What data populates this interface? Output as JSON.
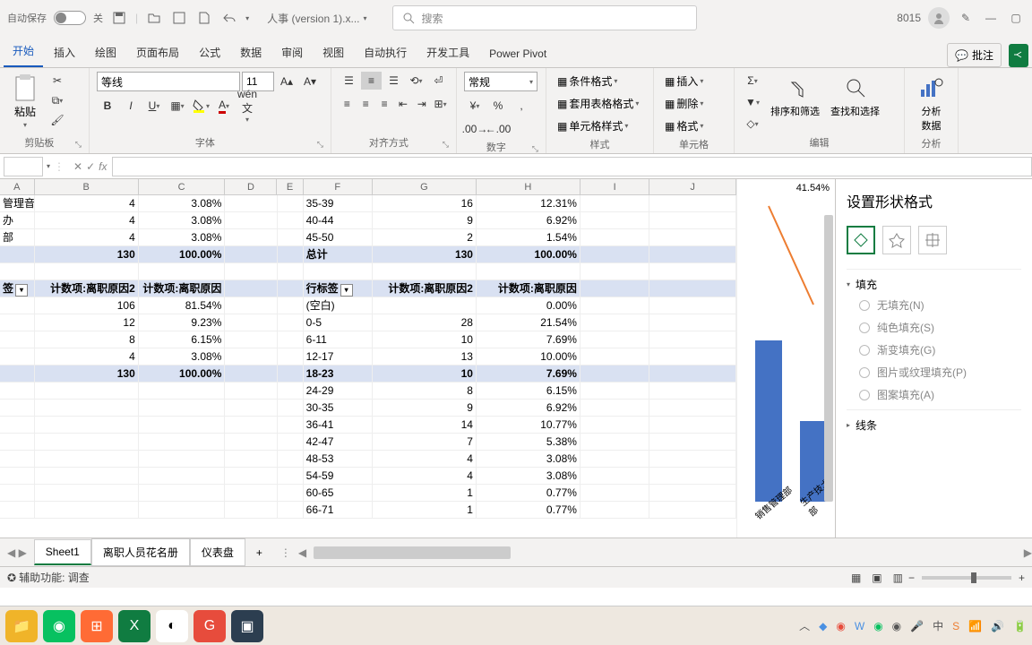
{
  "titlebar": {
    "autosave_label": "自动保存",
    "toggle_off": "关",
    "filename": "人事 (version 1).x...",
    "search_placeholder": "搜索",
    "user_id": "8015"
  },
  "tabs": {
    "items": [
      "开始",
      "插入",
      "绘图",
      "页面布局",
      "公式",
      "数据",
      "审阅",
      "视图",
      "自动执行",
      "开发工具",
      "Power Pivot"
    ],
    "comments": "批注"
  },
  "ribbon": {
    "clipboard": {
      "paste": "粘贴",
      "label": "剪贴板"
    },
    "font": {
      "name": "等线",
      "size": "11",
      "label": "字体",
      "wen": "wén"
    },
    "align": {
      "label": "对齐方式"
    },
    "number": {
      "format": "常规",
      "label": "数字"
    },
    "styles": {
      "conditional": "条件格式",
      "table": "套用表格格式",
      "cell": "单元格样式",
      "label": "样式"
    },
    "cells": {
      "insert": "插入",
      "delete": "删除",
      "format": "格式",
      "label": "单元格"
    },
    "editing": {
      "sort": "排序和筛选",
      "find": "查找和选择",
      "label": "编辑"
    },
    "analysis": {
      "analyze": "分析\n数据",
      "label": "分析"
    }
  },
  "panel": {
    "title": "设置形状格式",
    "fill": "填充",
    "nofill": "无填充(N)",
    "solid": "纯色填充(S)",
    "gradient": "渐变填充(G)",
    "picture": "图片或纹理填充(P)",
    "pattern": "图案填充(A)",
    "line": "线条"
  },
  "sheets": {
    "tabs": [
      "Sheet1",
      "离职人员花名册",
      "仪表盘"
    ]
  },
  "status": {
    "a11y": "辅助功能: 调查"
  },
  "grid": {
    "cols": [
      "A",
      "B",
      "C",
      "D",
      "E",
      "F",
      "G",
      "H",
      "I",
      "J"
    ],
    "widths": [
      40,
      120,
      100,
      60,
      30,
      80,
      120,
      120,
      80,
      100
    ],
    "rows": [
      [
        "管理音",
        "4",
        "3.08%",
        "",
        "",
        "35-39",
        "16",
        "12.31%",
        "",
        ""
      ],
      [
        "办",
        "4",
        "3.08%",
        "",
        "",
        "40-44",
        "9",
        "6.92%",
        "",
        ""
      ],
      [
        "部",
        "4",
        "3.08%",
        "",
        "",
        "45-50",
        "2",
        "1.54%",
        "",
        ""
      ],
      [
        "",
        "130",
        "100.00%",
        "",
        "",
        "总计",
        "130",
        "100.00%",
        "",
        ""
      ],
      [
        "",
        "",
        "",
        "",
        "",
        "",
        "",
        "",
        "",
        ""
      ],
      [
        "签",
        "计数项:离职原因2",
        "计数项:离职原因",
        "",
        "",
        "行标签",
        "计数项:离职原因2",
        "计数项:离职原因",
        "",
        ""
      ],
      [
        "",
        "106",
        "81.54%",
        "",
        "",
        "(空白)",
        "",
        "0.00%",
        "",
        ""
      ],
      [
        "",
        "12",
        "9.23%",
        "",
        "",
        "0-5",
        "28",
        "21.54%",
        "",
        ""
      ],
      [
        "",
        "8",
        "6.15%",
        "",
        "",
        "6-11",
        "10",
        "7.69%",
        "",
        ""
      ],
      [
        "",
        "4",
        "3.08%",
        "",
        "",
        "12-17",
        "13",
        "10.00%",
        "",
        ""
      ],
      [
        "",
        "130",
        "100.00%",
        "",
        "",
        "18-23",
        "10",
        "7.69%",
        "",
        ""
      ],
      [
        "",
        "",
        "",
        "",
        "",
        "24-29",
        "8",
        "6.15%",
        "",
        ""
      ],
      [
        "",
        "",
        "",
        "",
        "",
        "30-35",
        "9",
        "6.92%",
        "",
        ""
      ],
      [
        "",
        "",
        "",
        "",
        "",
        "36-41",
        "14",
        "10.77%",
        "",
        ""
      ],
      [
        "",
        "",
        "",
        "",
        "",
        "42-47",
        "7",
        "5.38%",
        "",
        ""
      ],
      [
        "",
        "",
        "",
        "",
        "",
        "48-53",
        "4",
        "3.08%",
        "",
        ""
      ],
      [
        "",
        "",
        "",
        "",
        "",
        "54-59",
        "4",
        "3.08%",
        "",
        ""
      ],
      [
        "",
        "",
        "",
        "",
        "",
        "60-65",
        "1",
        "0.77%",
        "",
        ""
      ],
      [
        "",
        "",
        "",
        "",
        "",
        "66-71",
        "1",
        "0.77%",
        "",
        ""
      ]
    ],
    "bold_rows": [
      3,
      10
    ],
    "hl_rows": [
      3,
      5,
      10
    ]
  },
  "chart": {
    "pct_label": "41.54%",
    "xlabels": [
      "销售管理部",
      "生产技术部"
    ]
  },
  "chart_data": {
    "type": "bar",
    "categories": [
      "销售管理部",
      "生产技术部"
    ],
    "values": [
      41.54,
      20
    ],
    "ylabel": "",
    "xlabel": "",
    "trendline": true
  }
}
